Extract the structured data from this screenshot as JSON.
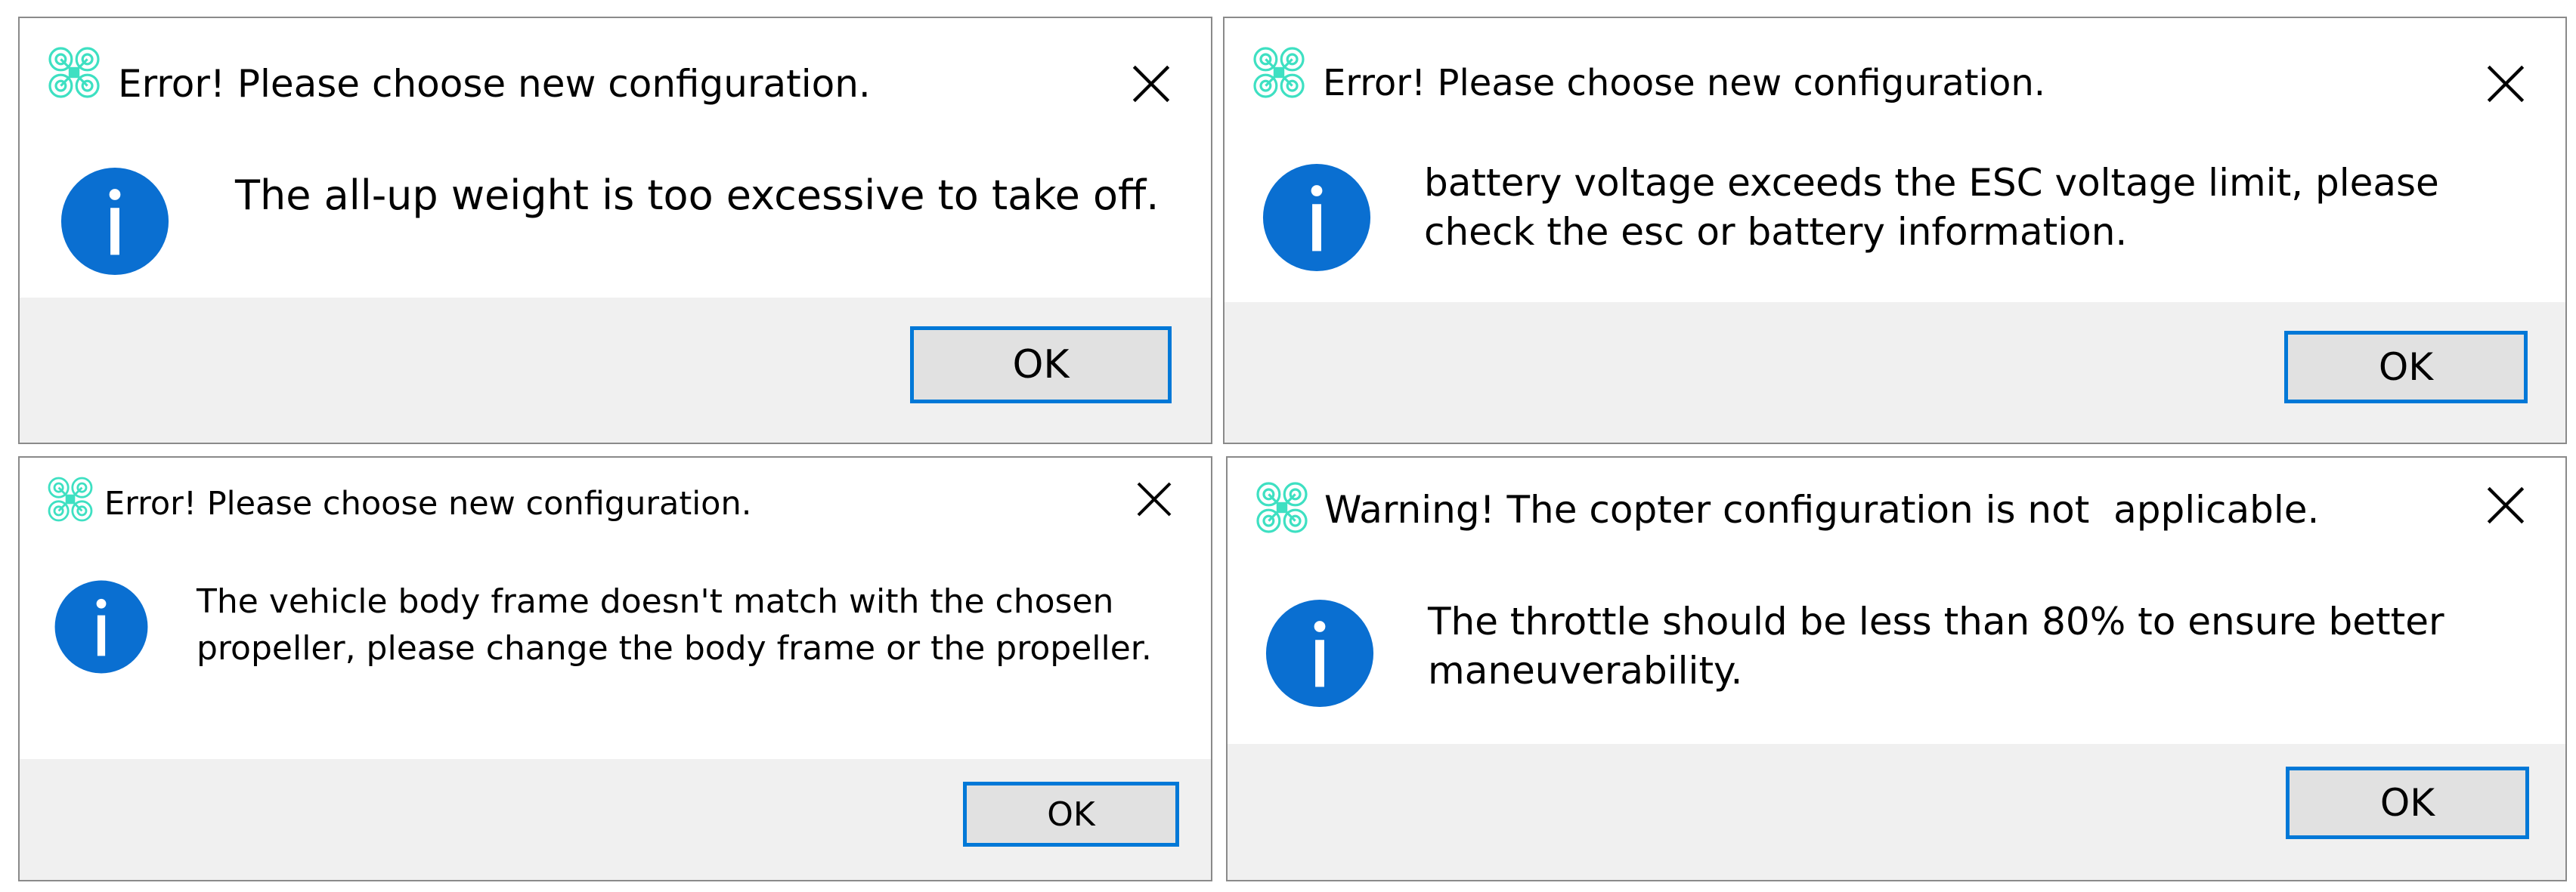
{
  "colors": {
    "accent": "#0078d7",
    "info_icon": "#0a6fd1",
    "app_icon": "#3ee0c2",
    "footer": "#f0f0f0",
    "button": "#e1e1e1"
  },
  "icons": {
    "app": "drone-app-icon",
    "info": "info-icon",
    "close": "close-icon"
  },
  "dialogs": [
    {
      "title": "Error! Please choose new configuration.",
      "message": "The all-up weight is too excessive to take off.",
      "ok_label": "OK"
    },
    {
      "title": "Error! Please choose new configuration.",
      "message": "battery voltage exceeds the ESC voltage limit, please check the esc or battery information.",
      "ok_label": "OK"
    },
    {
      "title": "Error! Please choose new configuration.",
      "message": "The vehicle body frame doesn't match with the chosen propeller, please change the body frame or the propeller.",
      "ok_label": "OK"
    },
    {
      "title": "Warning! The copter configuration is not  applicable.",
      "message": "The throttle should be less than 80% to ensure better maneuverability.",
      "ok_label": "OK"
    }
  ]
}
